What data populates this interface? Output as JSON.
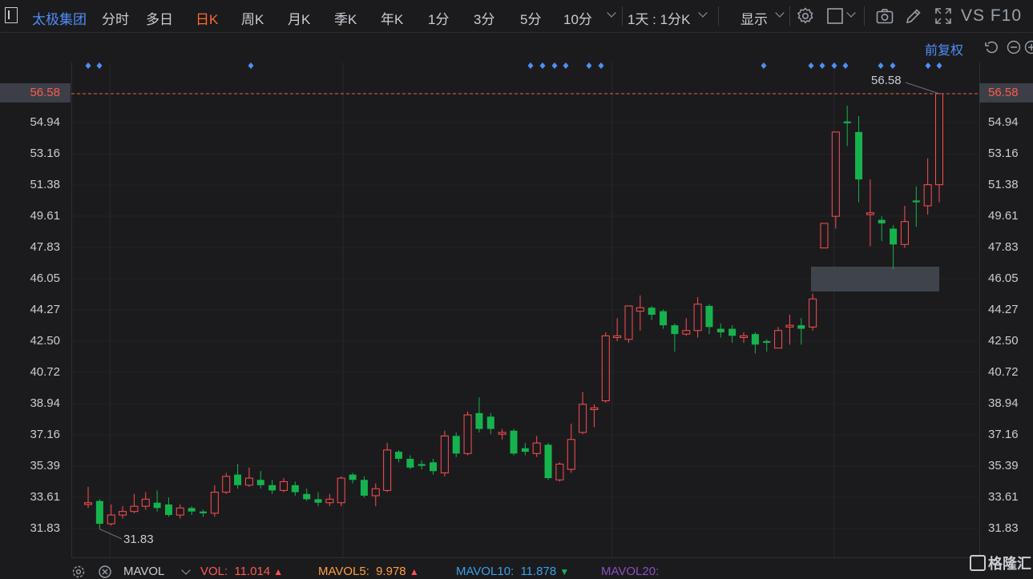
{
  "header": {
    "stock_name": "太极集团",
    "tabs": [
      "分时",
      "多日",
      "日K",
      "周K",
      "月K",
      "季K",
      "年K",
      "1分",
      "3分",
      "5分",
      "10分"
    ],
    "active_tab": "日K",
    "interval_select": "1天 : 1分K",
    "display_select": "显示",
    "extra_label": "VS F10"
  },
  "chart_subheader": {
    "adjust_label": "前复权"
  },
  "price_axis": {
    "ticks": [
      "56.58",
      "54.94",
      "53.16",
      "51.38",
      "49.61",
      "47.83",
      "46.05",
      "44.27",
      "42.50",
      "40.72",
      "38.94",
      "37.16",
      "35.39",
      "33.61",
      "31.83"
    ],
    "current_price": "56.58"
  },
  "annotations": {
    "high_label": "56.58",
    "low_label": "31.83"
  },
  "volume_bar": {
    "name": "MAVOL",
    "items": [
      {
        "label": "VOL:",
        "value": "11.014",
        "trend": "up",
        "color": "#ff5a4e"
      },
      {
        "label": "MAVOL5:",
        "value": "9.978",
        "trend": "up",
        "color": "#ff9f40"
      },
      {
        "label": "MAVOL10:",
        "value": "11.878",
        "trend": "down",
        "color": "#3aa0e6"
      },
      {
        "label": "MAVOL20:",
        "value": "",
        "trend": "",
        "color": "#8a4fc0"
      }
    ]
  },
  "brand": "格隆汇",
  "colors": {
    "up": "#ff4e4e",
    "down": "#16b34d",
    "accent": "#4f8ff7",
    "active_tab": "#ff6a2b"
  },
  "chart_data": {
    "type": "candlestick",
    "y_range": [
      31.83,
      56.58
    ],
    "candles": [
      {
        "o": 33.2,
        "c": 33.3,
        "h": 34.2,
        "l": 33.0
      },
      {
        "o": 33.4,
        "c": 32.1,
        "h": 33.5,
        "l": 31.8
      },
      {
        "o": 32.1,
        "c": 32.6,
        "h": 33.2,
        "l": 32.0
      },
      {
        "o": 32.6,
        "c": 32.8,
        "h": 33.1,
        "l": 32.4
      },
      {
        "o": 32.8,
        "c": 33.1,
        "h": 33.8,
        "l": 32.7
      },
      {
        "o": 33.1,
        "c": 33.5,
        "h": 33.9,
        "l": 32.9
      },
      {
        "o": 33.3,
        "c": 33.0,
        "h": 34.0,
        "l": 32.8
      },
      {
        "o": 33.2,
        "c": 32.6,
        "h": 33.6,
        "l": 32.5
      },
      {
        "o": 32.6,
        "c": 33.0,
        "h": 33.2,
        "l": 32.4
      },
      {
        "o": 33.0,
        "c": 32.8,
        "h": 33.1,
        "l": 32.6
      },
      {
        "o": 32.8,
        "c": 32.7,
        "h": 32.9,
        "l": 32.5
      },
      {
        "o": 32.7,
        "c": 33.9,
        "h": 34.3,
        "l": 32.5
      },
      {
        "o": 33.9,
        "c": 34.8,
        "h": 35.0,
        "l": 33.8
      },
      {
        "o": 34.9,
        "c": 34.3,
        "h": 35.5,
        "l": 34.1
      },
      {
        "o": 34.3,
        "c": 34.7,
        "h": 35.3,
        "l": 34.2
      },
      {
        "o": 34.6,
        "c": 34.3,
        "h": 35.1,
        "l": 34.1
      },
      {
        "o": 34.3,
        "c": 34.0,
        "h": 34.6,
        "l": 33.8
      },
      {
        "o": 34.0,
        "c": 34.5,
        "h": 34.7,
        "l": 33.9
      },
      {
        "o": 34.3,
        "c": 33.9,
        "h": 34.5,
        "l": 33.7
      },
      {
        "o": 33.8,
        "c": 33.5,
        "h": 34.1,
        "l": 33.4
      },
      {
        "o": 33.5,
        "c": 33.3,
        "h": 33.9,
        "l": 33.1
      },
      {
        "o": 33.3,
        "c": 33.5,
        "h": 33.8,
        "l": 33.1
      },
      {
        "o": 33.3,
        "c": 34.7,
        "h": 34.8,
        "l": 33.1
      },
      {
        "o": 34.9,
        "c": 34.6,
        "h": 35.0,
        "l": 34.4
      },
      {
        "o": 34.6,
        "c": 33.7,
        "h": 34.8,
        "l": 33.6
      },
      {
        "o": 33.7,
        "c": 34.1,
        "h": 34.4,
        "l": 33.1
      },
      {
        "o": 34.0,
        "c": 36.3,
        "h": 36.7,
        "l": 33.9
      },
      {
        "o": 36.2,
        "c": 35.8,
        "h": 36.3,
        "l": 35.6
      },
      {
        "o": 35.8,
        "c": 35.3,
        "h": 36.0,
        "l": 35.2
      },
      {
        "o": 35.5,
        "c": 35.4,
        "h": 35.7,
        "l": 35.2
      },
      {
        "o": 35.6,
        "c": 35.1,
        "h": 35.8,
        "l": 34.9
      },
      {
        "o": 35.0,
        "c": 37.1,
        "h": 37.4,
        "l": 34.8
      },
      {
        "o": 37.1,
        "c": 36.1,
        "h": 37.3,
        "l": 35.9
      },
      {
        "o": 36.1,
        "c": 38.3,
        "h": 38.5,
        "l": 36.0
      },
      {
        "o": 38.4,
        "c": 37.5,
        "h": 39.3,
        "l": 37.3
      },
      {
        "o": 38.2,
        "c": 37.5,
        "h": 38.4,
        "l": 37.2
      },
      {
        "o": 37.2,
        "c": 37.3,
        "h": 37.5,
        "l": 36.9
      },
      {
        "o": 37.4,
        "c": 36.1,
        "h": 37.5,
        "l": 36.0
      },
      {
        "o": 36.4,
        "c": 36.2,
        "h": 36.7,
        "l": 36.0
      },
      {
        "o": 36.1,
        "c": 36.7,
        "h": 37.1,
        "l": 35.9
      },
      {
        "o": 36.6,
        "c": 34.7,
        "h": 36.7,
        "l": 34.6
      },
      {
        "o": 34.6,
        "c": 35.5,
        "h": 35.6,
        "l": 34.5
      },
      {
        "o": 35.2,
        "c": 36.9,
        "h": 37.8,
        "l": 35.0
      },
      {
        "o": 37.3,
        "c": 38.9,
        "h": 39.6,
        "l": 37.2
      },
      {
        "o": 38.6,
        "c": 38.7,
        "h": 38.9,
        "l": 37.6
      },
      {
        "o": 39.1,
        "c": 42.8,
        "h": 43.0,
        "l": 39.0
      },
      {
        "o": 42.7,
        "c": 42.8,
        "h": 43.8,
        "l": 42.5
      },
      {
        "o": 42.6,
        "c": 44.5,
        "h": 44.5,
        "l": 42.4
      },
      {
        "o": 44.2,
        "c": 44.4,
        "h": 45.1,
        "l": 43.1
      },
      {
        "o": 44.4,
        "c": 44.0,
        "h": 44.5,
        "l": 43.7
      },
      {
        "o": 44.2,
        "c": 43.4,
        "h": 44.3,
        "l": 43.2
      },
      {
        "o": 43.4,
        "c": 42.9,
        "h": 43.5,
        "l": 41.9
      },
      {
        "o": 42.9,
        "c": 43.1,
        "h": 43.8,
        "l": 42.8
      },
      {
        "o": 43.1,
        "c": 44.6,
        "h": 45.0,
        "l": 42.7
      },
      {
        "o": 44.5,
        "c": 43.3,
        "h": 44.6,
        "l": 42.9
      },
      {
        "o": 43.2,
        "c": 43.0,
        "h": 43.5,
        "l": 42.7
      },
      {
        "o": 43.2,
        "c": 42.8,
        "h": 43.4,
        "l": 42.4
      },
      {
        "o": 42.7,
        "c": 42.8,
        "h": 43.0,
        "l": 42.4
      },
      {
        "o": 42.9,
        "c": 42.3,
        "h": 43.0,
        "l": 41.8
      },
      {
        "o": 42.5,
        "c": 42.4,
        "h": 42.6,
        "l": 41.9
      },
      {
        "o": 42.1,
        "c": 43.1,
        "h": 43.3,
        "l": 42.1
      },
      {
        "o": 43.3,
        "c": 43.4,
        "h": 44.0,
        "l": 42.3
      },
      {
        "o": 43.4,
        "c": 43.2,
        "h": 43.8,
        "l": 42.3
      },
      {
        "o": 43.3,
        "c": 44.9,
        "h": 45.2,
        "l": 43.1
      },
      {
        "o": 47.8,
        "c": 49.2,
        "h": 49.2,
        "l": 47.8
      },
      {
        "o": 49.6,
        "c": 54.4,
        "h": 54.4,
        "l": 48.9
      },
      {
        "o": 55.0,
        "c": 54.9,
        "h": 55.9,
        "l": 53.6
      },
      {
        "o": 54.4,
        "c": 51.7,
        "h": 55.3,
        "l": 50.4
      },
      {
        "o": 49.7,
        "c": 49.8,
        "h": 51.7,
        "l": 47.9
      },
      {
        "o": 49.4,
        "c": 49.2,
        "h": 49.6,
        "l": 48.2
      },
      {
        "o": 48.9,
        "c": 48.0,
        "h": 49.1,
        "l": 46.6
      },
      {
        "o": 48.0,
        "c": 49.3,
        "h": 50.2,
        "l": 47.8
      },
      {
        "o": 50.5,
        "c": 50.4,
        "h": 51.3,
        "l": 49.0
      },
      {
        "o": 50.2,
        "c": 51.4,
        "h": 52.9,
        "l": 49.7
      },
      {
        "o": 51.4,
        "c": 56.58,
        "h": 56.58,
        "l": 50.4
      }
    ]
  }
}
